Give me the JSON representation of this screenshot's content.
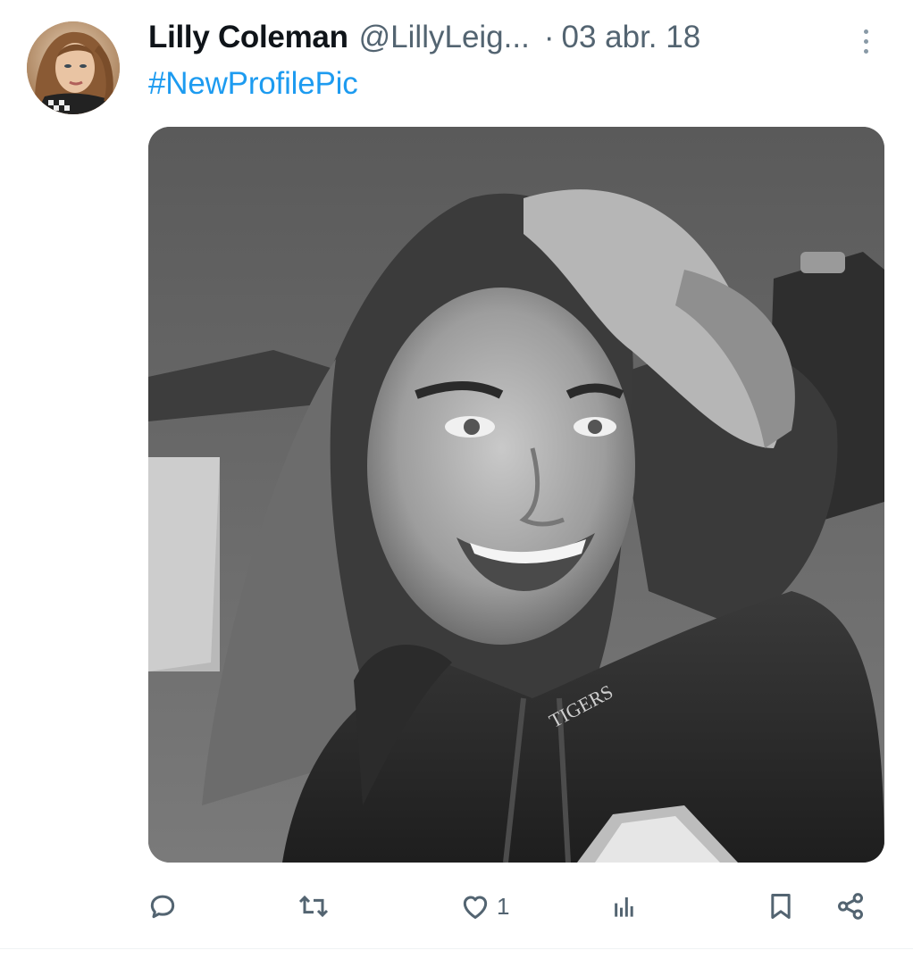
{
  "tweet": {
    "author_name": "Lilly Coleman",
    "author_handle": "@LillyLeig...",
    "separator": "·",
    "date": "03 abr. 18",
    "text": "#NewProfilePic",
    "media_alt_text": "",
    "sweatshirt_text": "TIGERS"
  },
  "actions": {
    "reply_icon": "reply-icon",
    "retweet_icon": "retweet-icon",
    "like_icon": "heart-icon",
    "like_count": "1",
    "views_icon": "views-chart-icon",
    "bookmark_icon": "bookmark-icon",
    "share_icon": "share-icon"
  },
  "colors": {
    "link": "#1d9bf0",
    "muted": "#536471",
    "text": "#0f1419"
  }
}
